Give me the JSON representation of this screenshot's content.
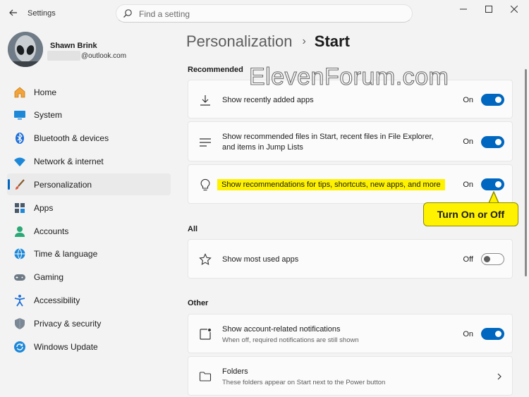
{
  "window": {
    "app_title": "Settings"
  },
  "search": {
    "placeholder": "Find a setting"
  },
  "profile": {
    "name": "Shawn Brink",
    "email": "@outlook.com"
  },
  "sidebar": {
    "items": [
      {
        "label": "Home",
        "icon": "home-icon"
      },
      {
        "label": "System",
        "icon": "system-icon"
      },
      {
        "label": "Bluetooth & devices",
        "icon": "bluetooth-icon"
      },
      {
        "label": "Network & internet",
        "icon": "wifi-icon"
      },
      {
        "label": "Personalization",
        "icon": "brush-icon",
        "active": true
      },
      {
        "label": "Apps",
        "icon": "apps-icon"
      },
      {
        "label": "Accounts",
        "icon": "accounts-icon"
      },
      {
        "label": "Time & language",
        "icon": "globe-icon"
      },
      {
        "label": "Gaming",
        "icon": "gamepad-icon"
      },
      {
        "label": "Accessibility",
        "icon": "accessibility-icon"
      },
      {
        "label": "Privacy & security",
        "icon": "shield-icon"
      },
      {
        "label": "Windows Update",
        "icon": "update-icon"
      }
    ]
  },
  "breadcrumb": {
    "parent": "Personalization",
    "current": "Start"
  },
  "sections": {
    "recommended": "Recommended",
    "all": "All",
    "other": "Other"
  },
  "settings": {
    "recently_added": {
      "label": "Show recently added apps",
      "state": "On"
    },
    "recommended_files": {
      "line1": "Show recommended files in Start, recent files in File Explorer,",
      "line2": "and items in Jump Lists",
      "state": "On"
    },
    "tips": {
      "label": "Show recommendations for tips, shortcuts, new apps, and more",
      "state": "On"
    },
    "most_used": {
      "label": "Show most used apps",
      "state": "Off"
    },
    "account_notifications": {
      "label": "Show account-related notifications",
      "sub": "When off, required notifications are still shown",
      "state": "On"
    },
    "folders": {
      "label": "Folders",
      "sub": "These folders appear on Start next to the Power button"
    }
  },
  "callout": {
    "text": "Turn On or Off"
  },
  "watermark": {
    "text": "ElevenForum.com"
  },
  "colors": {
    "accent": "#0067c0",
    "highlight": "#fff200"
  }
}
